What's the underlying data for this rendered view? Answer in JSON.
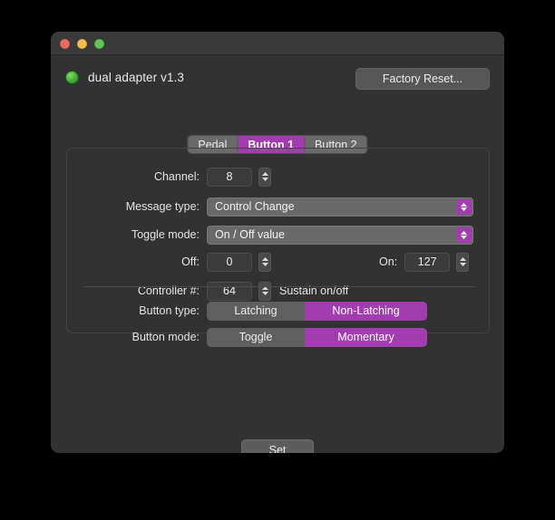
{
  "window": {
    "traffic_lights": [
      {
        "name": "close",
        "color": "#ec6a5e"
      },
      {
        "name": "minimize",
        "color": "#f4bd4f"
      },
      {
        "name": "zoom",
        "color": "#61c454"
      }
    ]
  },
  "header": {
    "device_name": "dual adapter v1.3",
    "status_color": "#3fa832",
    "factory_reset_label": "Factory Reset..."
  },
  "tabs": [
    {
      "label": "Pedal",
      "active": false
    },
    {
      "label": "Button 1",
      "active": true
    },
    {
      "label": "Button 2",
      "active": false
    }
  ],
  "form": {
    "channel": {
      "label": "Channel:",
      "value": "8"
    },
    "message_type": {
      "label": "Message type:",
      "value": "Control Change"
    },
    "toggle_mode": {
      "label": "Toggle mode:",
      "value": "On / Off value"
    },
    "off": {
      "label": "Off:",
      "value": "0"
    },
    "on": {
      "label": "On:",
      "value": "127"
    },
    "controller": {
      "label": "Controller #:",
      "value": "64",
      "note": "Sustain on/off"
    }
  },
  "segmented": {
    "button_type": {
      "label": "Button type:",
      "options": [
        "Latching",
        "Non-Latching"
      ],
      "selected": "Non-Latching"
    },
    "button_mode": {
      "label": "Button mode:",
      "options": [
        "Toggle",
        "Momentary"
      ],
      "selected": "Momentary"
    }
  },
  "footer": {
    "set_label": "Set"
  },
  "colors": {
    "accent": "#a23cb0",
    "window_bg": "#323232",
    "titlebar_bg": "#3a3a3a"
  }
}
